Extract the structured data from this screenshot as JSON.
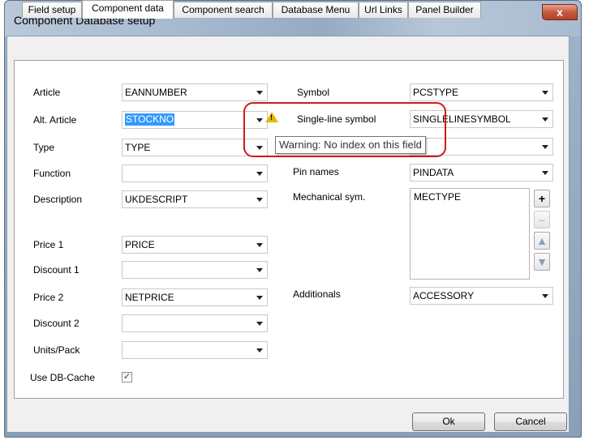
{
  "window": {
    "title": "Component Database setup",
    "close": "x"
  },
  "tabs": [
    "Field setup",
    "Component data",
    "Component search",
    "Database Menu",
    "Url Links",
    "Panel Builder"
  ],
  "left_fields": [
    {
      "label": "Article",
      "value": "EANNUMBER"
    },
    {
      "label": "Alt. Article",
      "value": "STOCKNO"
    },
    {
      "label": "Type",
      "value": "TYPE"
    },
    {
      "label": "Function",
      "value": ""
    },
    {
      "label": "Description",
      "value": "UKDESCRIPT"
    },
    {
      "label": "Price 1",
      "value": "PRICE"
    },
    {
      "label": "Discount 1",
      "value": ""
    },
    {
      "label": "Price 2",
      "value": "NETPRICE"
    },
    {
      "label": "Discount 2",
      "value": ""
    },
    {
      "label": "Units/Pack",
      "value": ""
    }
  ],
  "right_fields": [
    {
      "label": "Symbol",
      "value": "PCSTYPE"
    },
    {
      "label": "Single-line symbol",
      "value": "SINGLELINESYMBOL"
    },
    {
      "label": "Pin names",
      "value": "PINDATA"
    },
    {
      "label": "Mechanical sym.",
      "value": "MECTYPE"
    },
    {
      "label": "Additionals",
      "value": "ACCESSORY"
    }
  ],
  "use_db_cache": {
    "label": "Use DB-Cache",
    "checked": true,
    "mark": "✓"
  },
  "tooltip": "Warning: No index on this field",
  "icons": {
    "warning": "warning-icon",
    "add": "plus-icon",
    "remove": "minus-icon",
    "up": "arrow-up-icon",
    "down": "arrow-down-icon"
  },
  "side_buttons": {
    "add": "+",
    "remove": "–",
    "up": "▲",
    "down": "▼"
  },
  "buttons": {
    "ok": "Ok",
    "cancel": "Cancel"
  },
  "colors": {
    "highlight": "#d11818",
    "selection": "#3399ff",
    "warning": "#e8b800"
  }
}
